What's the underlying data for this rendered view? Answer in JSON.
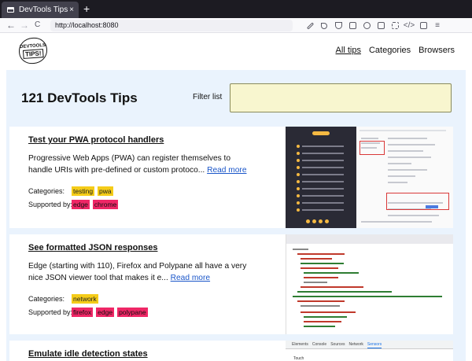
{
  "browser": {
    "tab_title": "DevTools Tips",
    "tab_close": "×",
    "new_tab": "+",
    "url": "http://localhost:8080",
    "back": "←",
    "forward": "→",
    "reload": "C"
  },
  "site": {
    "logo_top": "DEVTOOLS",
    "logo_bottom": "TIPS!",
    "nav": [
      {
        "label": "All tips",
        "active": true
      },
      {
        "label": "Categories",
        "active": false
      },
      {
        "label": "Browsers",
        "active": false
      }
    ]
  },
  "main": {
    "title": "121 DevTools Tips",
    "filter_label": "Filter list",
    "filter_value": ""
  },
  "labels": {
    "categories": "Categories:",
    "supported": "Supported by:",
    "read_more": "Read more"
  },
  "tips": [
    {
      "title": "Test your PWA protocol handlers",
      "description": "Progressive Web Apps (PWA) can register themselves to handle URIs with pre-defined or custom protoco...",
      "categories": [
        "testing",
        "pwa"
      ],
      "browsers": [
        "edge",
        "chrome"
      ]
    },
    {
      "title": "See formatted JSON responses",
      "description": "Edge (starting with 110), Firefox and Polypane all have a very nice JSON viewer tool that makes it e...",
      "categories": [
        "network"
      ],
      "browsers": [
        "firefox",
        "edge",
        "polypane"
      ]
    },
    {
      "title": "Emulate idle detection states"
    }
  ],
  "shot3": {
    "tabs": [
      "Elements",
      "Console",
      "Sources",
      "Network",
      "Sensors"
    ],
    "text": "Touch"
  },
  "colors": {
    "main_bg": "#eaf3fd",
    "filter_bg": "#f8f6cf",
    "category_tag": "#f5cc19",
    "browser_tag": "#ef2766",
    "link": "#1a56c9"
  }
}
